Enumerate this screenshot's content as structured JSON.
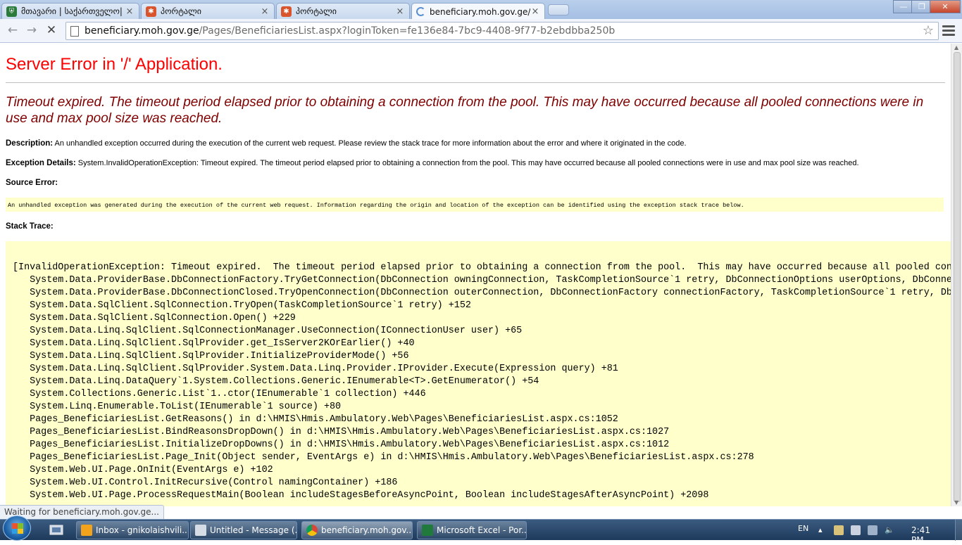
{
  "browser": {
    "tabs": [
      {
        "label": "მთავარი  | საქართველო|",
        "icon": "georgia-coat-icon",
        "active": false
      },
      {
        "label": "პორტალი",
        "icon": "portal-icon",
        "active": false
      },
      {
        "label": "პორტალი",
        "icon": "portal-icon",
        "active": false
      },
      {
        "label": "beneficiary.moh.gov.ge/P",
        "icon": "loading-icon",
        "active": true
      }
    ],
    "tab_close_glyph": "×",
    "window_controls": {
      "minimize": "—",
      "restore": "❐",
      "close": "✕"
    },
    "url_host": "beneficiary.moh.gov.ge",
    "url_path": "/Pages/BeneficiariesList.aspx?loginToken=fe136e84-7bc9-4408-9f77-b2ebdbba250b",
    "status_text": "Waiting for beneficiary.moh.gov.ge..."
  },
  "page": {
    "title": "Server Error in '/' Application.",
    "message": "Timeout expired.  The timeout period elapsed prior to obtaining a connection from the pool.  This may have occurred because all pooled connections were in use and max pool size was reached.",
    "description_label": "Description:",
    "description_text": "An unhandled exception occurred during the execution of the current web request. Please review the stack trace for more information about the error and where it originated in the code.",
    "exception_label": "Exception Details:",
    "exception_text": "System.InvalidOperationException: Timeout expired.  The timeout period elapsed prior to obtaining a connection from the pool.  This may have occurred because all pooled connections were in use and max pool size was reached.",
    "source_label": "Source Error:",
    "source_text": "An unhandled exception was generated during the execution of the current web request. Information regarding the origin and location of the exception can be identified using the exception stack trace below.",
    "stack_label": "Stack Trace:",
    "stack_lines": [
      "[InvalidOperationException: Timeout expired.  The timeout period elapsed prior to obtaining a connection from the pool.  This may have occurred because all pooled conn",
      "   System.Data.ProviderBase.DbConnectionFactory.TryGetConnection(DbConnection owningConnection, TaskCompletionSource`1 retry, DbConnectionOptions userOptions, DbConnec",
      "   System.Data.ProviderBase.DbConnectionClosed.TryOpenConnection(DbConnection outerConnection, DbConnectionFactory connectionFactory, TaskCompletionSource`1 retry, DbC",
      "   System.Data.SqlClient.SqlConnection.TryOpen(TaskCompletionSource`1 retry) +152",
      "   System.Data.SqlClient.SqlConnection.Open() +229",
      "   System.Data.Linq.SqlClient.SqlConnectionManager.UseConnection(IConnectionUser user) +65",
      "   System.Data.Linq.SqlClient.SqlProvider.get_IsServer2KOrEarlier() +40",
      "   System.Data.Linq.SqlClient.SqlProvider.InitializeProviderMode() +56",
      "   System.Data.Linq.SqlClient.SqlProvider.System.Data.Linq.Provider.IProvider.Execute(Expression query) +81",
      "   System.Data.Linq.DataQuery`1.System.Collections.Generic.IEnumerable<T>.GetEnumerator() +54",
      "   System.Collections.Generic.List`1..ctor(IEnumerable`1 collection) +446",
      "   System.Linq.Enumerable.ToList(IEnumerable`1 source) +80",
      "   Pages_BeneficiariesList.GetReasons() in d:\\HMIS\\Hmis.Ambulatory.Web\\Pages\\BeneficiariesList.aspx.cs:1052",
      "   Pages_BeneficiariesList.BindReasonsDropDown() in d:\\HMIS\\Hmis.Ambulatory.Web\\Pages\\BeneficiariesList.aspx.cs:1027",
      "   Pages_BeneficiariesList.InitializeDropDowns() in d:\\HMIS\\Hmis.Ambulatory.Web\\Pages\\BeneficiariesList.aspx.cs:1012",
      "   Pages_BeneficiariesList.Page_Init(Object sender, EventArgs e) in d:\\HMIS\\Hmis.Ambulatory.Web\\Pages\\BeneficiariesList.aspx.cs:278",
      "   System.Web.UI.Page.OnInit(EventArgs e) +102",
      "   System.Web.UI.Control.InitRecursive(Control namingContainer) +186",
      "   System.Web.UI.Page.ProcessRequestMain(Boolean includeStagesBeforeAsyncPoint, Boolean includeStagesAfterAsyncPoint) +2098"
    ]
  },
  "taskbar": {
    "tasks": [
      {
        "label": "Inbox - gnikolaishvili...",
        "icon": "outlook-icon",
        "active": false
      },
      {
        "label": "Untitled - Message (...",
        "icon": "message-icon",
        "active": false
      },
      {
        "label": "beneficiary.moh.gov...",
        "icon": "chrome-icon",
        "active": true
      },
      {
        "label": "Microsoft Excel - Por...",
        "icon": "excel-icon",
        "active": false
      }
    ],
    "language": "EN",
    "clock": "2:41 PM"
  },
  "colors": {
    "error_title": "#ff0000",
    "error_message": "#800000",
    "code_background": "#ffffcc"
  }
}
